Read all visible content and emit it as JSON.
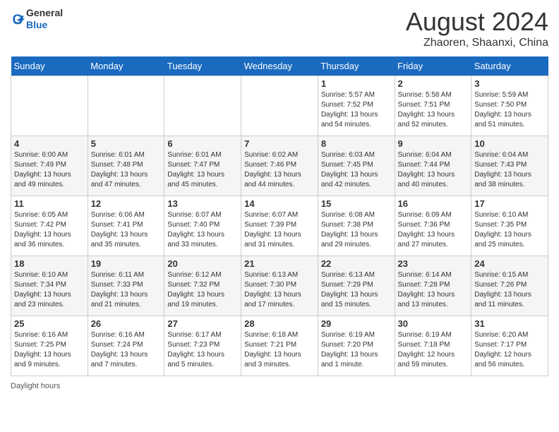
{
  "header": {
    "logo_line1": "General",
    "logo_line2": "Blue",
    "month_title": "August 2024",
    "location": "Zhaoren, Shaanxi, China"
  },
  "days_of_week": [
    "Sunday",
    "Monday",
    "Tuesday",
    "Wednesday",
    "Thursday",
    "Friday",
    "Saturday"
  ],
  "weeks": [
    [
      {
        "day": "",
        "info": ""
      },
      {
        "day": "",
        "info": ""
      },
      {
        "day": "",
        "info": ""
      },
      {
        "day": "",
        "info": ""
      },
      {
        "day": "1",
        "info": "Sunrise: 5:57 AM\nSunset: 7:52 PM\nDaylight: 13 hours and 54 minutes."
      },
      {
        "day": "2",
        "info": "Sunrise: 5:58 AM\nSunset: 7:51 PM\nDaylight: 13 hours and 52 minutes."
      },
      {
        "day": "3",
        "info": "Sunrise: 5:59 AM\nSunset: 7:50 PM\nDaylight: 13 hours and 51 minutes."
      }
    ],
    [
      {
        "day": "4",
        "info": "Sunrise: 6:00 AM\nSunset: 7:49 PM\nDaylight: 13 hours and 49 minutes."
      },
      {
        "day": "5",
        "info": "Sunrise: 6:01 AM\nSunset: 7:48 PM\nDaylight: 13 hours and 47 minutes."
      },
      {
        "day": "6",
        "info": "Sunrise: 6:01 AM\nSunset: 7:47 PM\nDaylight: 13 hours and 45 minutes."
      },
      {
        "day": "7",
        "info": "Sunrise: 6:02 AM\nSunset: 7:46 PM\nDaylight: 13 hours and 44 minutes."
      },
      {
        "day": "8",
        "info": "Sunrise: 6:03 AM\nSunset: 7:45 PM\nDaylight: 13 hours and 42 minutes."
      },
      {
        "day": "9",
        "info": "Sunrise: 6:04 AM\nSunset: 7:44 PM\nDaylight: 13 hours and 40 minutes."
      },
      {
        "day": "10",
        "info": "Sunrise: 6:04 AM\nSunset: 7:43 PM\nDaylight: 13 hours and 38 minutes."
      }
    ],
    [
      {
        "day": "11",
        "info": "Sunrise: 6:05 AM\nSunset: 7:42 PM\nDaylight: 13 hours and 36 minutes."
      },
      {
        "day": "12",
        "info": "Sunrise: 6:06 AM\nSunset: 7:41 PM\nDaylight: 13 hours and 35 minutes."
      },
      {
        "day": "13",
        "info": "Sunrise: 6:07 AM\nSunset: 7:40 PM\nDaylight: 13 hours and 33 minutes."
      },
      {
        "day": "14",
        "info": "Sunrise: 6:07 AM\nSunset: 7:39 PM\nDaylight: 13 hours and 31 minutes."
      },
      {
        "day": "15",
        "info": "Sunrise: 6:08 AM\nSunset: 7:38 PM\nDaylight: 13 hours and 29 minutes."
      },
      {
        "day": "16",
        "info": "Sunrise: 6:09 AM\nSunset: 7:36 PM\nDaylight: 13 hours and 27 minutes."
      },
      {
        "day": "17",
        "info": "Sunrise: 6:10 AM\nSunset: 7:35 PM\nDaylight: 13 hours and 25 minutes."
      }
    ],
    [
      {
        "day": "18",
        "info": "Sunrise: 6:10 AM\nSunset: 7:34 PM\nDaylight: 13 hours and 23 minutes."
      },
      {
        "day": "19",
        "info": "Sunrise: 6:11 AM\nSunset: 7:33 PM\nDaylight: 13 hours and 21 minutes."
      },
      {
        "day": "20",
        "info": "Sunrise: 6:12 AM\nSunset: 7:32 PM\nDaylight: 13 hours and 19 minutes."
      },
      {
        "day": "21",
        "info": "Sunrise: 6:13 AM\nSunset: 7:30 PM\nDaylight: 13 hours and 17 minutes."
      },
      {
        "day": "22",
        "info": "Sunrise: 6:13 AM\nSunset: 7:29 PM\nDaylight: 13 hours and 15 minutes."
      },
      {
        "day": "23",
        "info": "Sunrise: 6:14 AM\nSunset: 7:28 PM\nDaylight: 13 hours and 13 minutes."
      },
      {
        "day": "24",
        "info": "Sunrise: 6:15 AM\nSunset: 7:26 PM\nDaylight: 13 hours and 11 minutes."
      }
    ],
    [
      {
        "day": "25",
        "info": "Sunrise: 6:16 AM\nSunset: 7:25 PM\nDaylight: 13 hours and 9 minutes."
      },
      {
        "day": "26",
        "info": "Sunrise: 6:16 AM\nSunset: 7:24 PM\nDaylight: 13 hours and 7 minutes."
      },
      {
        "day": "27",
        "info": "Sunrise: 6:17 AM\nSunset: 7:23 PM\nDaylight: 13 hours and 5 minutes."
      },
      {
        "day": "28",
        "info": "Sunrise: 6:18 AM\nSunset: 7:21 PM\nDaylight: 13 hours and 3 minutes."
      },
      {
        "day": "29",
        "info": "Sunrise: 6:19 AM\nSunset: 7:20 PM\nDaylight: 13 hours and 1 minute."
      },
      {
        "day": "30",
        "info": "Sunrise: 6:19 AM\nSunset: 7:18 PM\nDaylight: 12 hours and 59 minutes."
      },
      {
        "day": "31",
        "info": "Sunrise: 6:20 AM\nSunset: 7:17 PM\nDaylight: 12 hours and 56 minutes."
      }
    ]
  ],
  "footer": {
    "daylight_hours_label": "Daylight hours"
  }
}
